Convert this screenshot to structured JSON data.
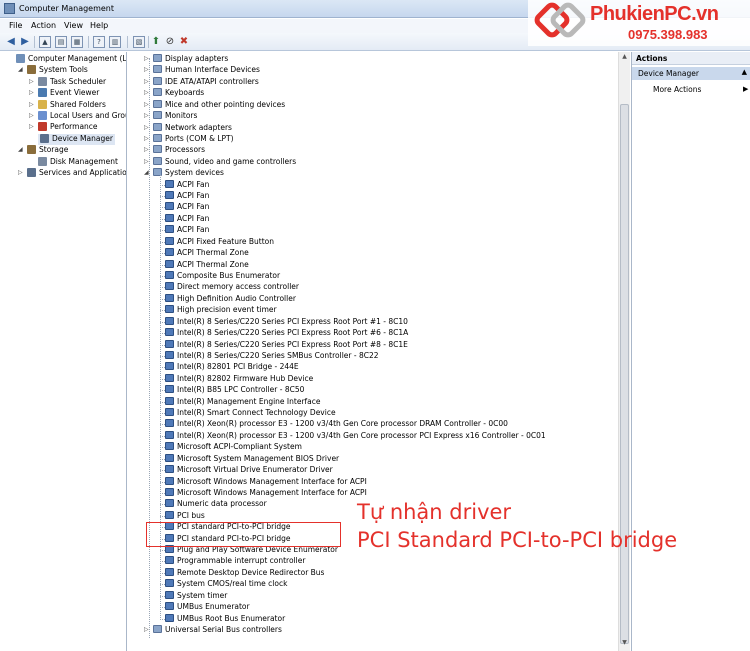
{
  "window": {
    "title": "Computer Management"
  },
  "menu": [
    "File",
    "Action",
    "View",
    "Help"
  ],
  "left_tree": [
    {
      "label": "Computer Management (Local",
      "indent": 0,
      "expander": "",
      "color": "#6f8fb8"
    },
    {
      "label": "System Tools",
      "indent": 1,
      "expander": "◢",
      "color": "#8a6d3b"
    },
    {
      "label": "Task Scheduler",
      "indent": 2,
      "expander": "▷",
      "color": "#7a8aa0"
    },
    {
      "label": "Event Viewer",
      "indent": 2,
      "expander": "▷",
      "color": "#4a7ab0"
    },
    {
      "label": "Shared Folders",
      "indent": 2,
      "expander": "▷",
      "color": "#d8b24a"
    },
    {
      "label": "Local Users and Groups",
      "indent": 2,
      "expander": "▷",
      "color": "#6a8fcf"
    },
    {
      "label": "Performance",
      "indent": 2,
      "expander": "▷",
      "color": "#c0392b"
    },
    {
      "label": "Device Manager",
      "indent": 2,
      "expander": "",
      "color": "#5a6f8c",
      "selected": true
    },
    {
      "label": "Storage",
      "indent": 1,
      "expander": "◢",
      "color": "#8a6d3b"
    },
    {
      "label": "Disk Management",
      "indent": 2,
      "expander": "",
      "color": "#7a8aa0"
    },
    {
      "label": "Services and Applications",
      "indent": 1,
      "expander": "▷",
      "color": "#5a6f8c"
    }
  ],
  "device_categories_top": [
    "Display adapters",
    "Human Interface Devices",
    "IDE ATA/ATAPI controllers",
    "Keyboards",
    "Mice and other pointing devices",
    "Monitors",
    "Network adapters",
    "Ports (COM & LPT)",
    "Processors",
    "Sound, video and game controllers",
    "System devices"
  ],
  "system_devices": [
    "ACPI Fan",
    "ACPI Fan",
    "ACPI Fan",
    "ACPI Fan",
    "ACPI Fan",
    "ACPI Fixed Feature Button",
    "ACPI Thermal Zone",
    "ACPI Thermal Zone",
    "Composite Bus Enumerator",
    "Direct memory access controller",
    "High Definition Audio Controller",
    "High precision event timer",
    "Intel(R) 8 Series/C220 Series PCI Express Root Port #1 - 8C10",
    "Intel(R) 8 Series/C220 Series PCI Express Root Port #6 - 8C1A",
    "Intel(R) 8 Series/C220 Series PCI Express Root Port #8 - 8C1E",
    "Intel(R) 8 Series/C220 Series SMBus Controller - 8C22",
    "Intel(R) 82801 PCI Bridge - 244E",
    "Intel(R) 82802 Firmware Hub Device",
    "Intel(R) B85 LPC Controller - 8C50",
    "Intel(R) Management Engine Interface",
    "Intel(R) Smart Connect Technology Device",
    "Intel(R) Xeon(R) processor E3 - 1200 v3/4th Gen Core processor DRAM Controller - 0C00",
    "Intel(R) Xeon(R) processor E3 - 1200 v3/4th Gen Core processor PCI Express x16 Controller - 0C01",
    "Microsoft ACPI-Compliant System",
    "Microsoft System Management BIOS Driver",
    "Microsoft Virtual Drive Enumerator Driver",
    "Microsoft Windows Management Interface for ACPI",
    "Microsoft Windows Management Interface for ACPI",
    "Numeric data processor",
    "PCI bus",
    "PCI standard PCI-to-PCI bridge",
    "PCI standard PCI-to-PCI bridge",
    "Plug and Play Software Device Enumerator",
    "Programmable interrupt controller",
    "Remote Desktop Device Redirector Bus",
    "System CMOS/real time clock",
    "System timer",
    "UMBus Enumerator",
    "UMBus Root Bus Enumerator"
  ],
  "device_categories_bottom": [
    "Universal Serial Bus controllers"
  ],
  "actions": {
    "header": "Actions",
    "section": "Device Manager",
    "more": "More Actions"
  },
  "logo": {
    "brand": "PhukienPC.vn",
    "phone": "0975.398.983"
  },
  "annotation": {
    "line1": "Tự nhận driver",
    "line2": "PCI Standard PCI-to-PCI bridge"
  }
}
